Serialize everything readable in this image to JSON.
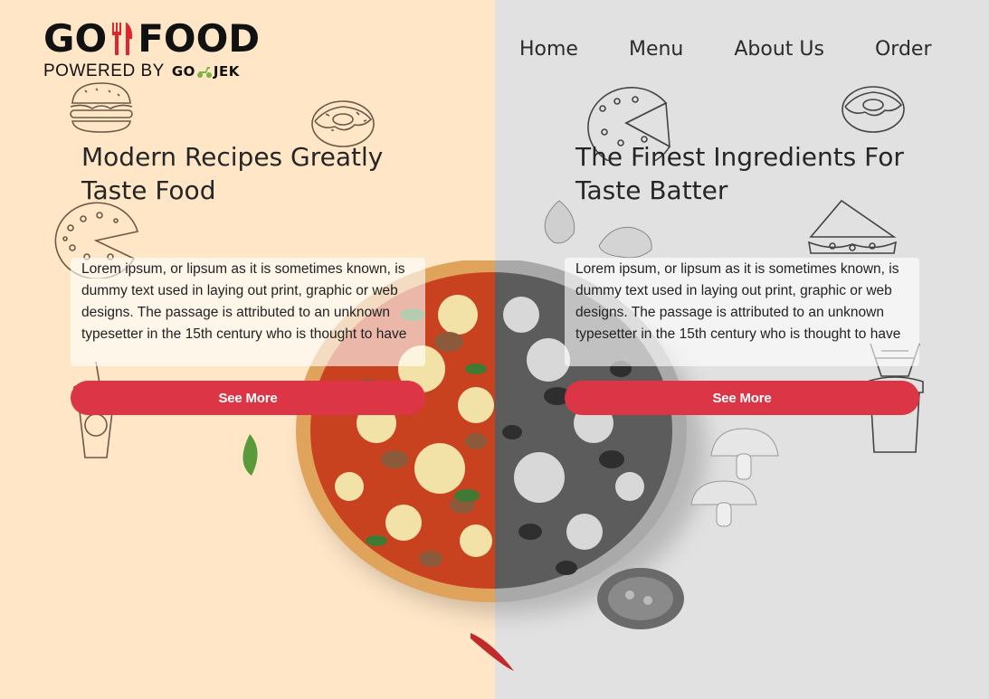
{
  "brand": {
    "logo_left": "GO",
    "logo_right": "FOOD",
    "powered_by": "POWERED BY",
    "gojek_left": "GO",
    "gojek_right": "JEK",
    "logo_icon": "fork-knife-icon",
    "gojek_icon": "scooter-icon"
  },
  "nav": {
    "items": [
      {
        "label": "Home"
      },
      {
        "label": "Menu"
      },
      {
        "label": "About Us"
      },
      {
        "label": "Order"
      }
    ]
  },
  "left": {
    "headline": "Modern Recipes Greatly Taste Food",
    "description": "Lorem ipsum, or lipsum as it is sometimes known, is dummy text used in laying out print, graphic or web designs. The passage is attributed to an unknown typesetter in the 15th century who is thought to have",
    "button_label": "See More"
  },
  "right": {
    "headline": "The Finest Ingredients For Taste Batter",
    "description": "Lorem ipsum, or lipsum as it is sometimes known, is dummy text used in laying out print, graphic or web designs. The passage is attributed to an unknown typesetter in the 15th century who is thought to have",
    "button_label": "See More"
  },
  "colors": {
    "left_bg": "#ffe6c7",
    "right_bg": "#e1e1e1",
    "button": "#dc3545",
    "text": "#262626"
  },
  "decor": {
    "icons": [
      "burger-doodle-icon",
      "donut-doodle-icon",
      "pizza-doodle-icon",
      "sandwich-doodle-icon",
      "drink-doodle-icon",
      "pizza-image",
      "basil-leaf-icon",
      "garlic-icon",
      "mushroom-icon",
      "tomato-icon",
      "chili-icon"
    ]
  }
}
